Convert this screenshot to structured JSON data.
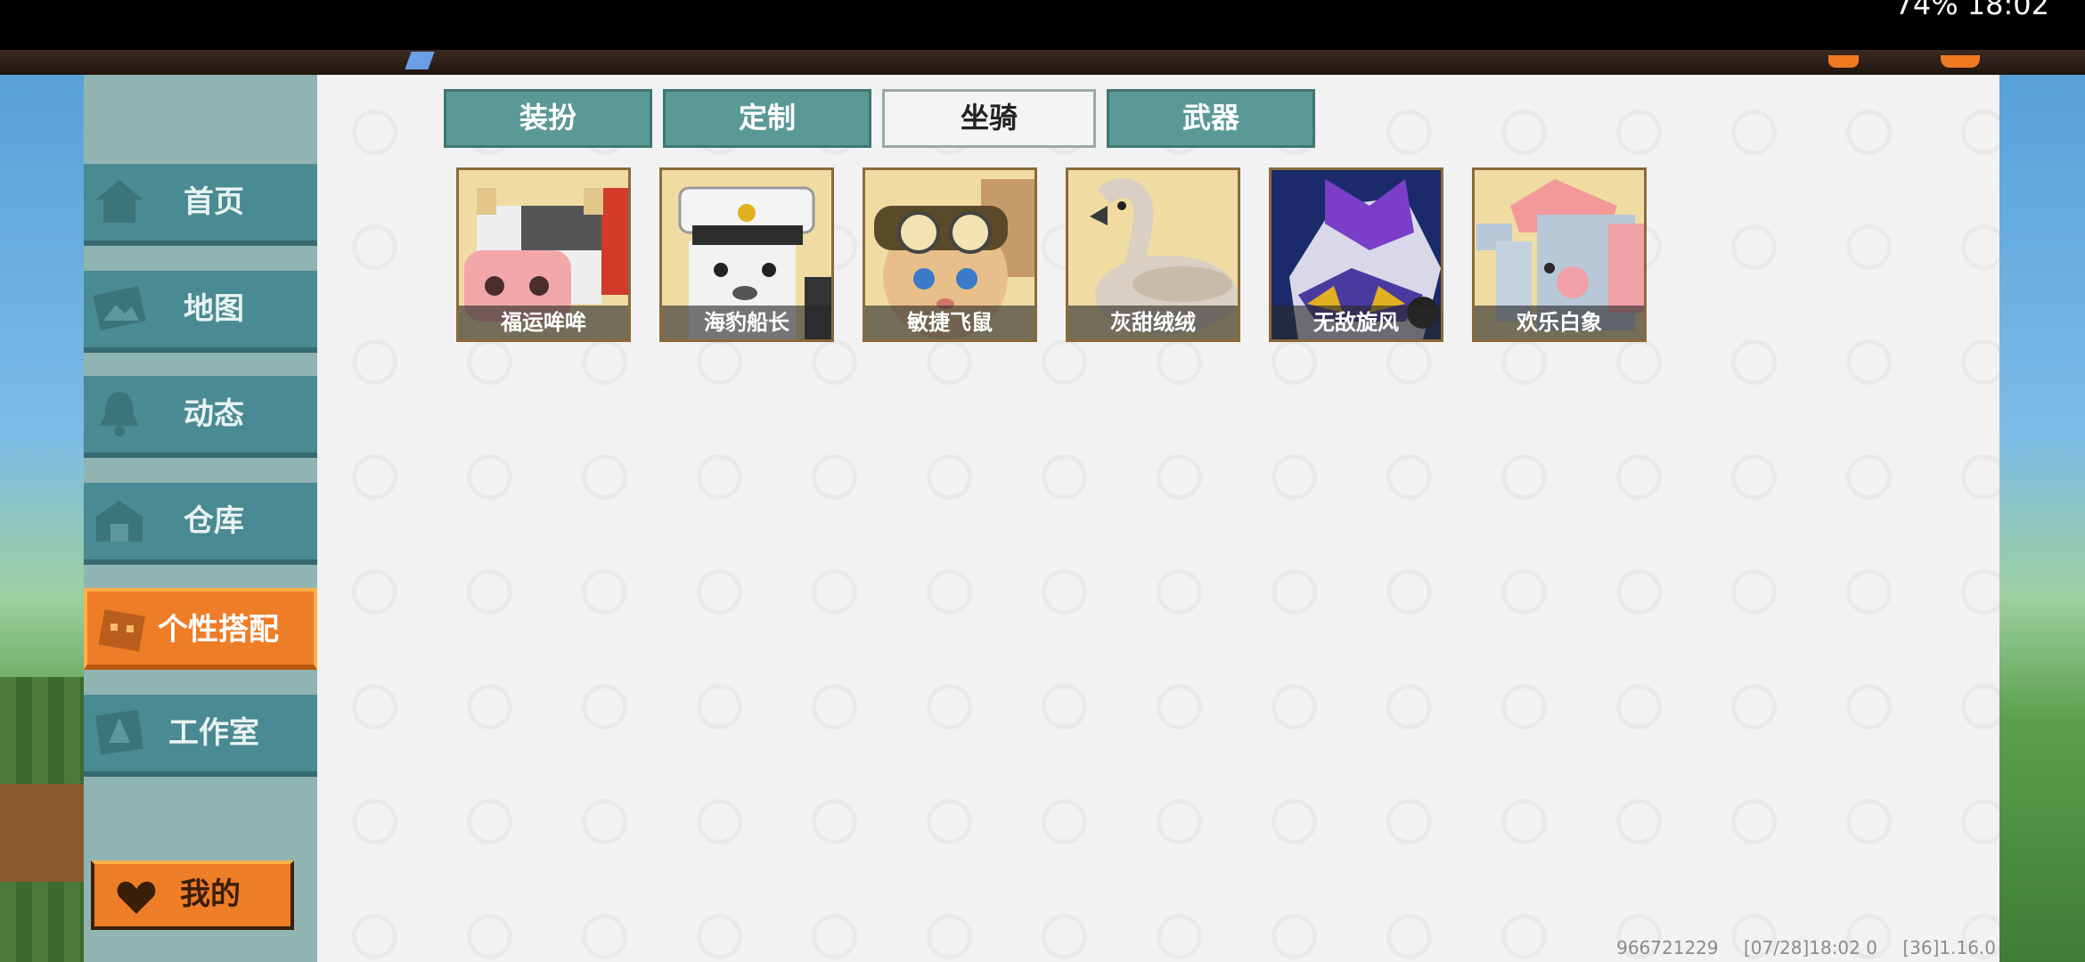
{
  "status_bar": {
    "right_text": "74% 18:02"
  },
  "sidebar": {
    "items": [
      {
        "label": "首页",
        "icon": "home-icon"
      },
      {
        "label": "地图",
        "icon": "map-icon"
      },
      {
        "label": "动态",
        "icon": "bell-icon"
      },
      {
        "label": "仓库",
        "icon": "warehouse-icon"
      },
      {
        "label": "个性搭配",
        "icon": "avatar-icon",
        "active": true
      },
      {
        "label": "工作室",
        "icon": "studio-icon"
      }
    ],
    "mine_label": "我的"
  },
  "tabs": [
    {
      "label": "装扮"
    },
    {
      "label": "定制"
    },
    {
      "label": "坐骑",
      "active": true
    },
    {
      "label": "武器"
    }
  ],
  "items": [
    {
      "label": "福运哞哞",
      "icon": "cow-mount-icon"
    },
    {
      "label": "海豹船长",
      "icon": "seal-captain-mount-icon"
    },
    {
      "label": "敏捷飞鼠",
      "icon": "flying-squirrel-mount-icon"
    },
    {
      "label": "灰甜绒绒",
      "icon": "swan-mount-icon"
    },
    {
      "label": "无敌旋风",
      "icon": "race-car-mount-icon"
    },
    {
      "label": "欢乐白象",
      "icon": "elephant-mount-icon"
    }
  ],
  "footer": {
    "user_id": "966721229",
    "timestamp": "[07/28]18:02 0",
    "version": "[36]1.16.0"
  },
  "colors": {
    "accent_orange": "#ee7d28",
    "nav_teal": "#4a8a92",
    "tab_teal": "#5a9996"
  }
}
